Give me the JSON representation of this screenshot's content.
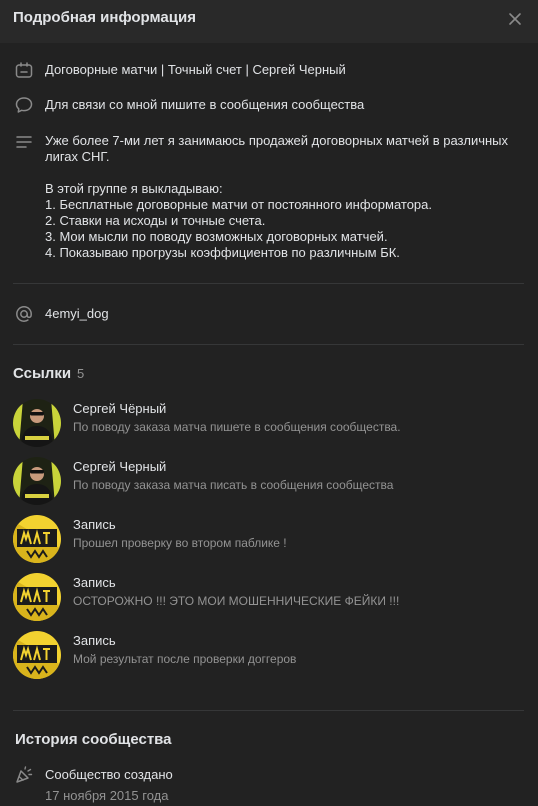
{
  "header": {
    "title": "Подробная информация"
  },
  "info": {
    "name": "Договорные матчи | Точный счет | Сергей Черный",
    "contact": "Для связи со мной пишите в сообщения сообщества",
    "description": "Уже более 7-ми лет я занимаюсь продажей договорных матчей в различных лигах СНГ.\n\nВ этой группе я выкладываю:\n1. Бесплатные договорные матчи от постоянного информатора.\n2. Ставки на исходы и точные счета.\n3. Мои мысли по поводу возможных договорных матчей.\n4. Показываю прогрузы коэффициентов по различным БК.",
    "short_address": "4emyi_dog"
  },
  "links": {
    "title": "Ссылки",
    "count": "5",
    "items": [
      {
        "title": "Сергей Чёрный",
        "subtitle": "По поводу заказа матча пишете в сообщения сообщества.",
        "avatar": "person"
      },
      {
        "title": "Сергей Черный",
        "subtitle": "По поводу заказа матча писать в сообщения сообщества",
        "avatar": "person"
      },
      {
        "title": "Запись",
        "subtitle": "Прошел проверку во втором паблике !",
        "avatar": "logo"
      },
      {
        "title": "Запись",
        "subtitle": "ОСТОРОЖНО !!! ЭТО МОИ МОШЕННИЧЕСКИЕ ФЕЙКИ !!!",
        "avatar": "logo"
      },
      {
        "title": "Запись",
        "subtitle": "Мой результат после проверки доггеров",
        "avatar": "logo"
      }
    ]
  },
  "history": {
    "title": "История сообщества",
    "event": "Сообщество создано",
    "date": "17 ноября 2015 года"
  },
  "colors": {
    "background": "#222222",
    "header": "#292929",
    "text": "#e1e3e6",
    "secondary": "#939393",
    "logo_yellow": "#f2d230"
  }
}
